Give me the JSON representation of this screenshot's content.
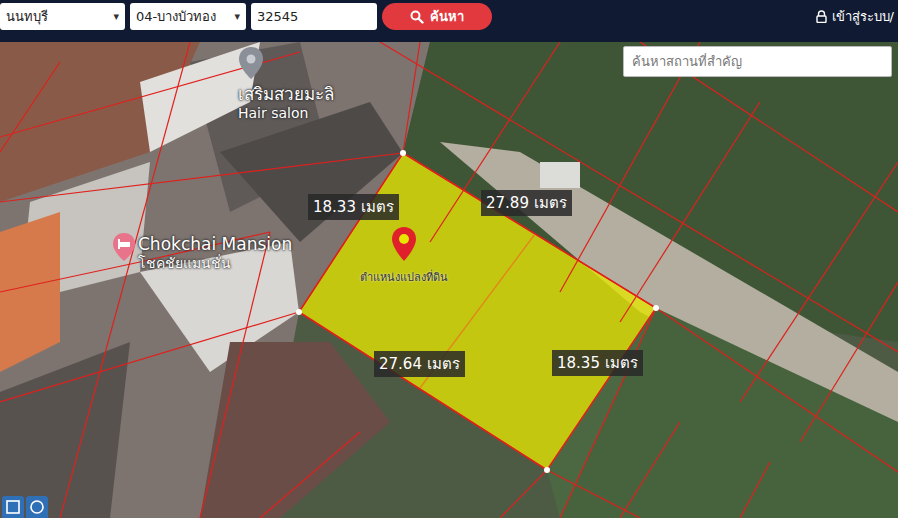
{
  "topbar": {
    "province": {
      "value": "นนทบุรี"
    },
    "district": {
      "value": "04-บางบัวทอง"
    },
    "parcel_number": "32545",
    "search_button": "ค้นหา",
    "login": "เข้าสู่ระบบ/"
  },
  "map": {
    "place_search": {
      "placeholder": "ค้นหาสถานที่สำคัญ"
    },
    "places": [
      {
        "name": "เสริมสวยมะลิ",
        "subtitle": "Hair salon",
        "kind": "salon"
      },
      {
        "name": "Chokchai Mansion",
        "subtitle": "โชคชัยแมนชั่น",
        "kind": "hotel"
      }
    ],
    "parcel": {
      "label": "ตำแหน่งแปลงที่ดิน"
    },
    "measurements": [
      "18.33 เมตร",
      "27.89 เมตร",
      "27.64 เมตร",
      "18.35 เมตร"
    ]
  }
}
